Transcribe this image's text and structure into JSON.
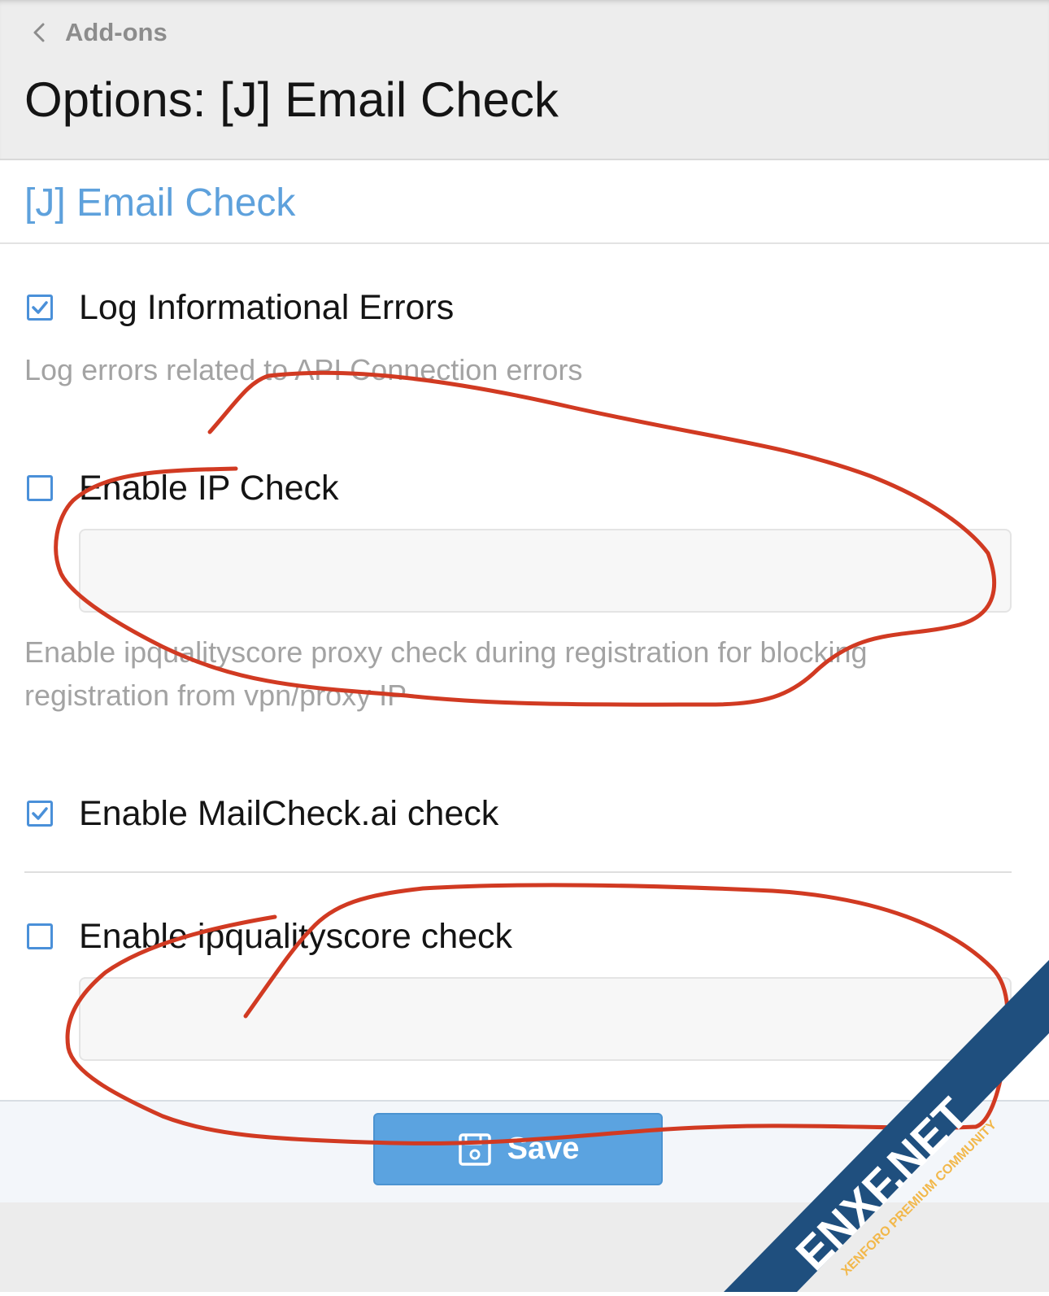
{
  "header": {
    "breadcrumb": "Add-ons",
    "title": "Options: [J] Email Check"
  },
  "section": {
    "title": "[J] Email Check"
  },
  "options": [
    {
      "label": "Log Informational Errors",
      "checked": true,
      "hint": "Log errors related to API Connection errors"
    },
    {
      "label": "Enable IP Check",
      "checked": false,
      "input_value": "",
      "hint": "Enable ipqualityscore proxy check during registration for blocking registration from vpn/proxy IP"
    },
    {
      "label": "Enable MailCheck.ai check",
      "checked": true
    },
    {
      "label": "Enable ipqualityscore check",
      "checked": false,
      "input_value": ""
    }
  ],
  "footer": {
    "save_label": "Save"
  },
  "watermark": {
    "brand": "ENXF.NET",
    "tagline": "XENFORO PREMIUM COMMUNITY"
  },
  "colors": {
    "accent": "#5ea1dc",
    "checkbox": "#4a90d9",
    "annotation": "#d13a22",
    "watermark_blue": "#1f4f7e"
  }
}
